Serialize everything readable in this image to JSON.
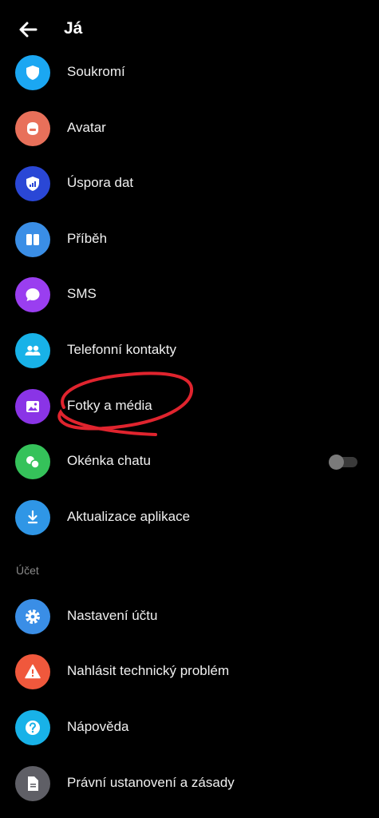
{
  "header": {
    "title": "Já",
    "back_icon": "arrow-left-icon"
  },
  "items": [
    {
      "label": "Soukromí",
      "icon": "shield-icon",
      "color": "#1ba7f2"
    },
    {
      "label": "Avatar",
      "icon": "avatar-face-icon",
      "color": "#e8705a"
    },
    {
      "label": "Úspora dat",
      "icon": "data-saver-icon",
      "color": "#2a47d6"
    },
    {
      "label": "Příběh",
      "icon": "story-icon",
      "color": "#3a8ee6"
    },
    {
      "label": "SMS",
      "icon": "chat-bubble-icon",
      "color": "#9a3ef0"
    },
    {
      "label": "Telefonní kontakty",
      "icon": "contacts-icon",
      "color": "#18b2e8"
    },
    {
      "label": "Fotky a média",
      "icon": "photo-icon",
      "color": "#8a34e6"
    },
    {
      "label": "Okénka chatu",
      "icon": "chat-heads-icon",
      "color": "#35c25a"
    },
    {
      "label": "Aktualizace aplikace",
      "icon": "download-icon",
      "color": "#2f96e6"
    }
  ],
  "toggle": {
    "on": false
  },
  "section_title": "Účet",
  "account_items": [
    {
      "label": "Nastavení účtu",
      "icon": "gear-icon",
      "color": "#3a8ee6"
    },
    {
      "label": "Nahlásit technický problém",
      "icon": "warning-icon",
      "color": "#f0583c"
    },
    {
      "label": "Nápověda",
      "icon": "help-icon",
      "color": "#18b2e8"
    },
    {
      "label": "Právní ustanovení a zásady",
      "icon": "document-icon",
      "color": "#5f5f66"
    }
  ],
  "annotation_color": "#e0242e"
}
